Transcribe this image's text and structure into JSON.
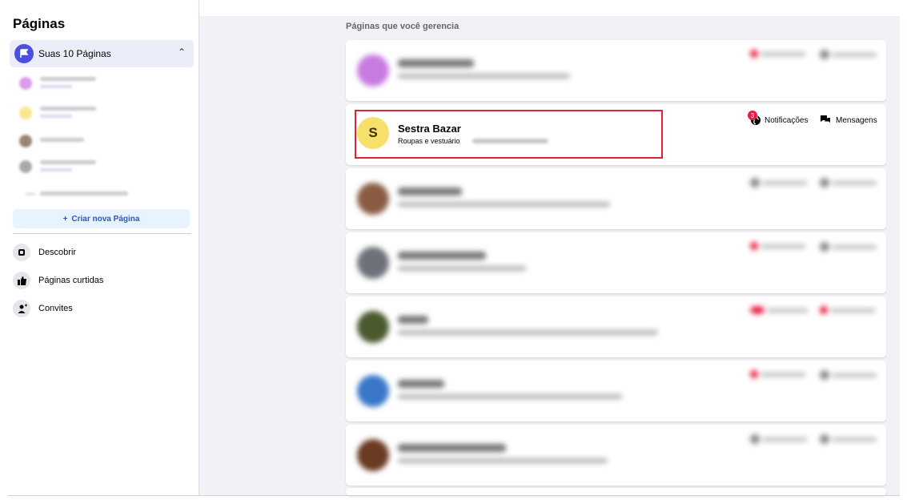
{
  "sidebar": {
    "title": "Páginas",
    "pages_group_label": "Suas 10 Páginas",
    "create_label": "Criar nova Página",
    "nav": [
      {
        "label": "Descobrir",
        "icon": "compass-icon"
      },
      {
        "label": "Páginas curtidas",
        "icon": "thumbs-up-icon"
      },
      {
        "label": "Convites",
        "icon": "invite-person-icon"
      }
    ]
  },
  "main": {
    "title": "Páginas que você gerencia",
    "highlighted_page": {
      "initial": "S",
      "name": "Sestra Bazar",
      "category": "Roupas e vestuário",
      "notifications_label": "Notificações",
      "notifications_count": "3",
      "messages_label": "Mensagens"
    }
  },
  "colors": {
    "accent": "#4b4fde",
    "highlight_border": "#e0242f",
    "badge": "#e41e3f"
  }
}
